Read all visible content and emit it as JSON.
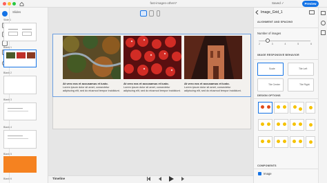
{
  "window": {
    "title": "fast-images-others*",
    "saved": "Saved ✓",
    "preview": "Preview"
  },
  "slides_panel": {
    "heading": "Slides",
    "items": [
      {
        "label": "Slide 1"
      },
      {
        "label": "Blank 1"
      },
      {
        "label": "Blank 2"
      },
      {
        "label": "Blank 3"
      },
      {
        "label": "Blank 4"
      },
      {
        "label": "Blank 5"
      },
      {
        "label": "Blank 6"
      },
      {
        "label": "Blank 7"
      }
    ]
  },
  "slide": {
    "cards": [
      {
        "image": "forest-river",
        "heading": "At vero eos et accusamus et iusto.",
        "body": "Lorem ipsum dolor sit amet, consectetur adipiscing elit, sed do eiusmod tempor incididunt."
      },
      {
        "image": "red-berries",
        "heading": "At vero eos et accusamus et iusto.",
        "body": "Lorem ipsum dolor sit amet, consectetur adipiscing elit, sed do eiusmod tempor incididunt."
      },
      {
        "image": "canyon-building",
        "heading": "At vero eos et accusamus et iusto.",
        "body": "Lorem ipsum dolor sit amet, consectetur adipiscing elit, sed do eiusmod tempor incididunt."
      }
    ]
  },
  "timeline": {
    "label": "Timeline"
  },
  "properties": {
    "component_name": "Image_Grid_1",
    "sections": {
      "alignment": "ALIGNMENT AND SPACING",
      "responsive": "IMAGE RESPONSIVE BEHAVIOR",
      "design": "DESIGN OPTIONS",
      "components": "COMPONENTS"
    },
    "number_of_images": {
      "label": "Number of images",
      "ticks": [
        "2",
        "3",
        "4",
        "5",
        "6"
      ],
      "value": 3
    },
    "responsive_options": [
      {
        "label": "Scale",
        "selected": true
      },
      {
        "label": "Tile Left",
        "selected": false
      },
      {
        "label": "Tile Center",
        "selected": false
      },
      {
        "label": "Tile Right",
        "selected": false
      }
    ],
    "components": [
      {
        "label": "Image",
        "checked": true
      }
    ]
  },
  "colors": {
    "accent": "#1473e6",
    "orange_thumb": "#f58220",
    "gold": "#f5c200"
  }
}
